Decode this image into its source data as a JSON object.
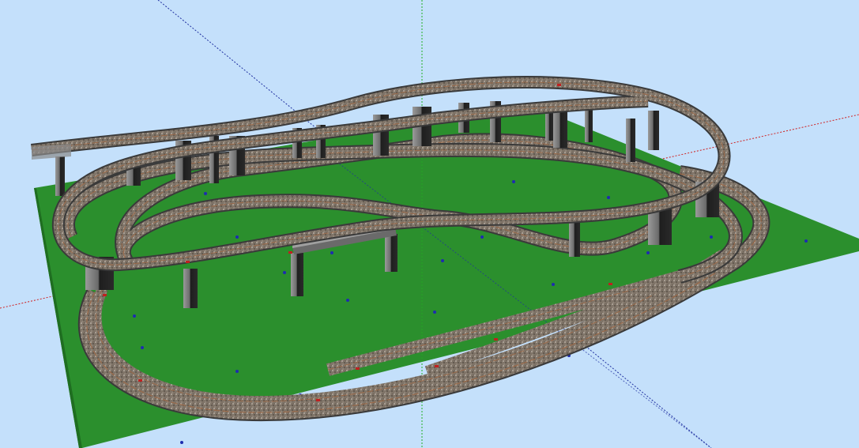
{
  "scene": {
    "kind": "3d-model-railway-layout",
    "colors": {
      "sky": "#c4e0fb",
      "baseboard": "#2b8f2d",
      "baseboard_edge": "#1f6e21",
      "ballast": "#7a6e62",
      "rail": "#a07050",
      "pier": "#2b2b2b",
      "pier_light": "#8a8a8a",
      "marker": "#1d2bb0",
      "axis_red": "#d02020",
      "axis_green": "#20b020",
      "axis_blue": "#2030a0"
    },
    "axes": [
      "red-axis",
      "green-axis",
      "blue-axis"
    ],
    "elements": [
      "baseboard",
      "lower-loop-track",
      "middle-loop-track",
      "upper-elevated-track",
      "figure-eight-track",
      "bridge-deck",
      "support-piers",
      "ground-markers",
      "siding-tracks"
    ]
  }
}
